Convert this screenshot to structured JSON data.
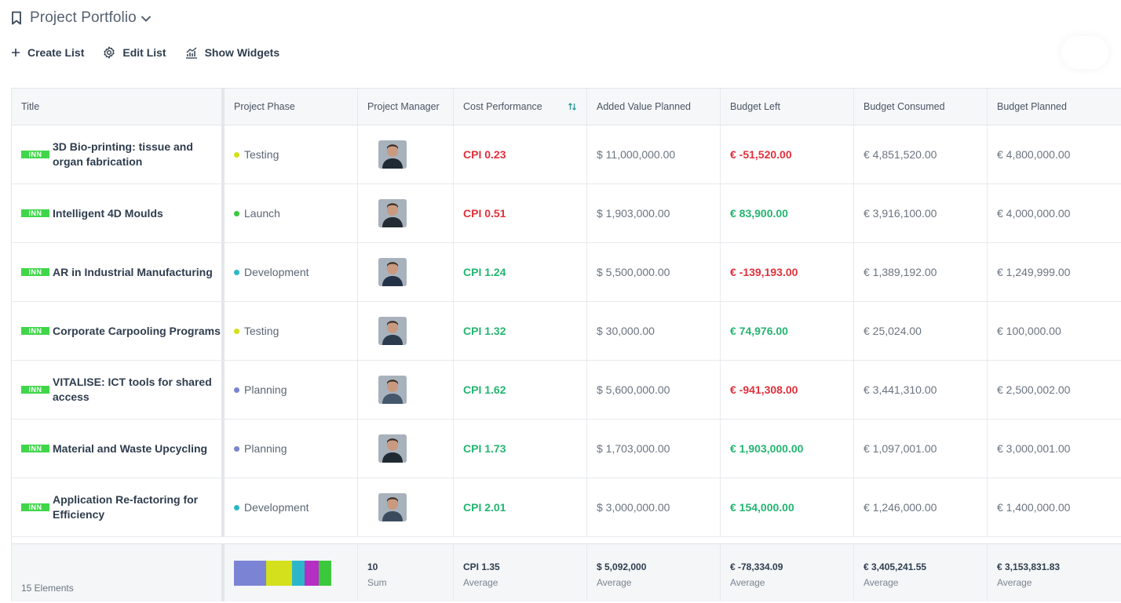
{
  "header": {
    "title": "Project Portfolio"
  },
  "toolbar": {
    "create": "Create List",
    "edit": "Edit List",
    "widgets": "Show Widgets"
  },
  "colors": {
    "tag": "#40d64a",
    "red": "#e0313c",
    "green": "#23b570"
  },
  "columns": [
    "Title",
    "Project Phase",
    "Project Manager",
    "Cost Performance",
    "Added Value Planned",
    "Budget Left",
    "Budget Consumed",
    "Budget Planned"
  ],
  "rows": [
    {
      "tag": "INN",
      "title": "3D Bio-printing: tissue and organ fabrication",
      "phase": "Testing",
      "phase_color": "#d4e01c",
      "cpi": "CPI 0.23",
      "cpi_status": "red",
      "added": "$ 11,000,000.00",
      "left": "€ -51,520.00",
      "left_status": "red",
      "consumed": "€ 4,851,520.00",
      "planned": "€ 4,800,000.00"
    },
    {
      "tag": "INN",
      "title": "Intelligent 4D Moulds",
      "phase": "Launch",
      "phase_color": "#3cc83c",
      "cpi": "CPI 0.51",
      "cpi_status": "red",
      "added": "$ 1,903,000.00",
      "left": "€ 83,900.00",
      "left_status": "green",
      "consumed": "€ 3,916,100.00",
      "planned": "€ 4,000,000.00"
    },
    {
      "tag": "INN",
      "title": "AR in Industrial Manufacturing",
      "phase": "Development",
      "phase_color": "#2cb6c9",
      "cpi": "CPI 1.24",
      "cpi_status": "green",
      "added": "$ 5,500,000.00",
      "left": "€ -139,193.00",
      "left_status": "red",
      "consumed": "€ 1,389,192.00",
      "planned": "€ 1,249,999.00"
    },
    {
      "tag": "INN",
      "title": "Corporate Carpooling Programs",
      "phase": "Testing",
      "phase_color": "#d4e01c",
      "cpi": "CPI 1.32",
      "cpi_status": "green",
      "added": "$ 30,000.00",
      "left": "€ 74,976.00",
      "left_status": "green",
      "consumed": "€ 25,024.00",
      "planned": "€ 100,000.00"
    },
    {
      "tag": "INN",
      "title": "VITALISE: ICT tools for shared access",
      "phase": "Planning",
      "phase_color": "#7b84d4",
      "cpi": "CPI 1.62",
      "cpi_status": "green",
      "added": "$ 5,600,000.00",
      "left": "€ -941,308.00",
      "left_status": "red",
      "consumed": "€ 3,441,310.00",
      "planned": "€ 2,500,002.00"
    },
    {
      "tag": "INN",
      "title": "Material and Waste Upcycling",
      "phase": "Planning",
      "phase_color": "#7b84d4",
      "cpi": "CPI 1.73",
      "cpi_status": "green",
      "added": "$ 1,703,000.00",
      "left": "€ 1,903,000.00",
      "left_status": "green",
      "consumed": "€ 1,097,001.00",
      "planned": "€ 3,000,001.00"
    },
    {
      "tag": "INN",
      "title": "Application Re-factoring for Efficiency",
      "phase": "Development",
      "phase_color": "#2cb6c9",
      "cpi": "CPI 2.01",
      "cpi_status": "green",
      "added": "$ 3,000,000.00",
      "left": "€ 154,000.00",
      "left_status": "green",
      "consumed": "€ 1,246,000.00",
      "planned": "€ 1,400,000.00"
    }
  ],
  "footer": {
    "elements": "15 Elements",
    "phase_distribution": [
      {
        "phase": "Planning",
        "color": "#7b84d4",
        "share": 0.33
      },
      {
        "phase": "Testing",
        "color": "#d4e01c",
        "share": 0.27
      },
      {
        "phase": "Development",
        "color": "#2cb6c9",
        "share": 0.13
      },
      {
        "phase": "Other",
        "color": "#b52fc4",
        "share": 0.14
      },
      {
        "phase": "Launch",
        "color": "#3cc83c",
        "share": 0.13
      }
    ],
    "manager": {
      "value": "10",
      "label": "Sum"
    },
    "cpi": {
      "value": "CPI 1.35",
      "label": "Average"
    },
    "added": {
      "value": "$ 5,092,000",
      "label": "Average"
    },
    "left": {
      "value": "€ -78,334.09",
      "label": "Average"
    },
    "consumed": {
      "value": "€ 3,405,241.55",
      "label": "Average"
    },
    "planned": {
      "value": "€ 3,153,831.83",
      "label": "Average"
    }
  }
}
